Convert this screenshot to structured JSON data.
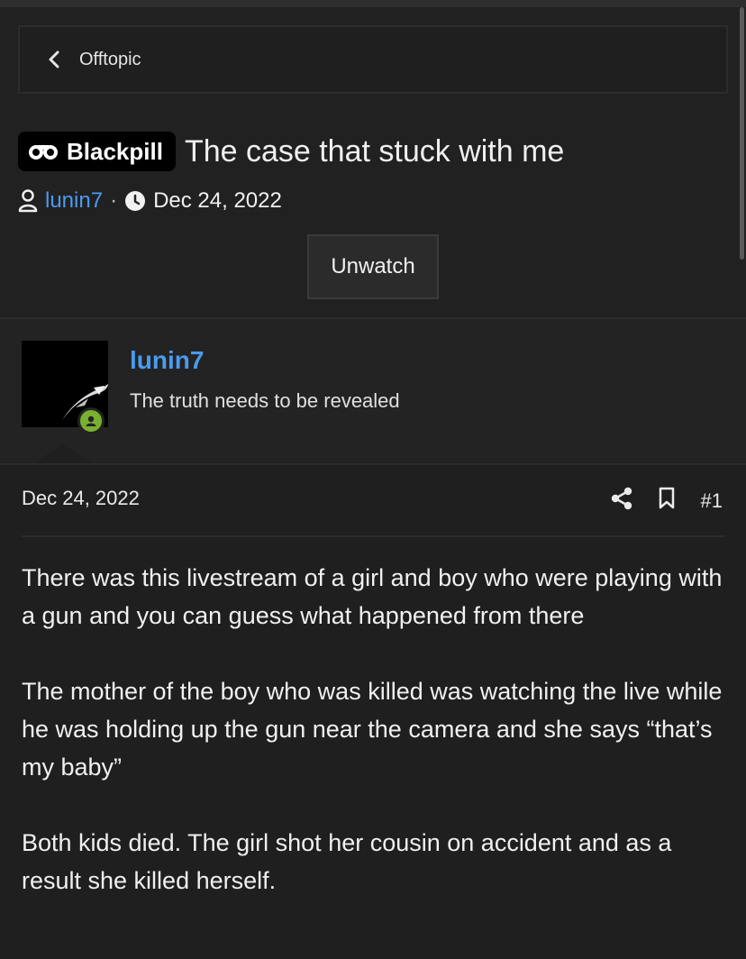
{
  "breadcrumb": {
    "label": "Offtopic"
  },
  "thread": {
    "prefix": "Blackpill",
    "title": "The case that stuck with me",
    "author": "lunin7",
    "separator": "·",
    "date": "Dec 24, 2022",
    "watch_button": "Unwatch"
  },
  "user": {
    "name": "lunin7",
    "title": "The truth needs to be revealed",
    "status_color": "#7ab030"
  },
  "post": {
    "date": "Dec 24, 2022",
    "number": "#1",
    "paragraphs": [
      "There was this livestream of a girl and boy who were playing with a gun and you can guess what happened from there",
      "The mother of the boy who was killed was watching the live while he was holding up the gun near the camera and she says “that’s my baby”",
      "Both kids died. The girl shot her cousin on accident and as a result she killed herself."
    ]
  },
  "colors": {
    "accent": "#4a9bef",
    "background": "#212121"
  }
}
